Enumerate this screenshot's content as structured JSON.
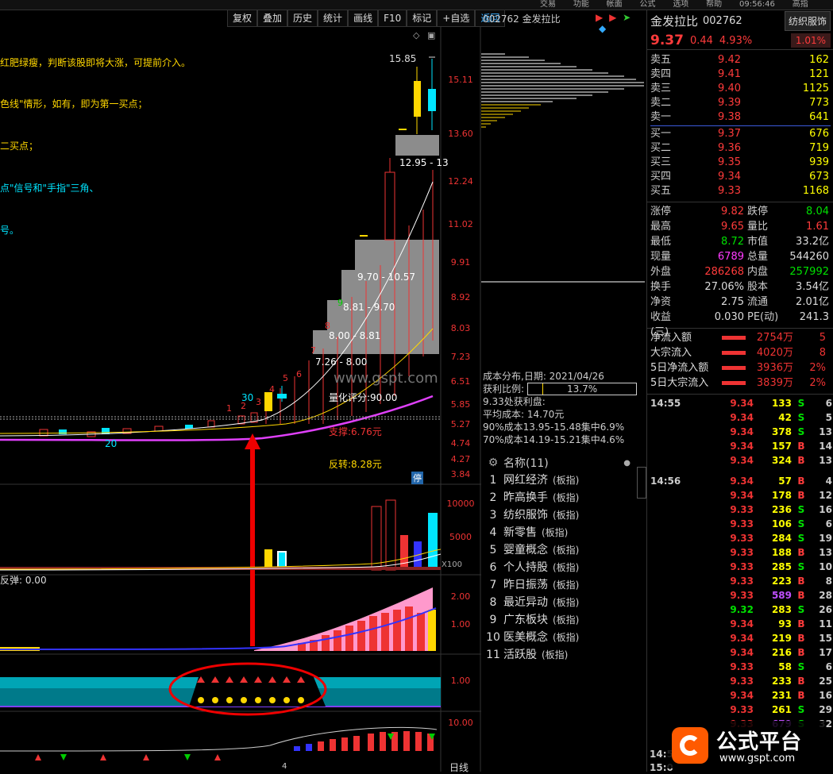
{
  "topbar": {
    "items": [
      "交易",
      "功能",
      "帐面",
      "公式",
      "选项",
      "帮助",
      "",
      "高指"
    ],
    "clock": "09:56:46"
  },
  "toolbar": {
    "buttons": [
      "复权",
      "叠加",
      "历史",
      "统计",
      "画线",
      "F10",
      "标记",
      "+自选",
      "返回"
    ]
  },
  "chart_header": {
    "code_name": "002762 金发拉比"
  },
  "annotations": {
    "note1": "红肥绿瘦，判断该股即将大涨，可提前介入。",
    "note2": "色线\"情形，如有，即为第一买点；",
    "note3": "二买点；",
    "note4": "点\"信号和\"手指\"三角、",
    "note5": "号。",
    "high_label": "15.85",
    "num30": "30",
    "num20": "20",
    "box1": "12.95 - 13",
    "box2": "9.70 - 10.57",
    "box3": "8.81 - 9.70",
    "box4": "8.00 - 8.81",
    "box5": "7.26 - 8.00",
    "score": "量化评分:90.00",
    "support": "支撑:6.76元",
    "reversal": "反转:8.28元",
    "ting": "停",
    "n1": "1",
    "n2": "2",
    "n3": "3",
    "n4": "4",
    "n5": "5",
    "n6": "6",
    "n7": "7",
    "n8": "8",
    "n9": "9",
    "watermark": "www.gspt.com",
    "x100": "X100",
    "rebound": "反弹: 0.00",
    "bottom_day": "日线",
    "bottom_4": "4",
    "logo_text": "公式平台",
    "logo_url": "www.gspt.com"
  },
  "price_axis": [
    "15.11",
    "13.60",
    "12.24",
    "11.02",
    "9.91",
    "8.92",
    "8.03",
    "7.23",
    "6.51",
    "5.85",
    "5.27",
    "4.74",
    "4.27",
    "3.84"
  ],
  "vol_axis": [
    "10000",
    "5000"
  ],
  "ind_axis": [
    "2.00",
    "1.00"
  ],
  "ind2_axis": [
    "1.00"
  ],
  "ind3_axis": [
    "10.00"
  ],
  "chip": {
    "date_label": "成本分布,日期: 2021/04/26",
    "profit_label": "获利比例:",
    "profit_value": "13.7%",
    "line1": "9.33处获利盘:",
    "line2": "平均成本: 14.70元",
    "line3": "90%成本13.95-15.48集中6.9%",
    "line4": "70%成本14.19-15.21集中4.6%"
  },
  "sectors": {
    "header": "名称(11)",
    "items": [
      {
        "idx": "1",
        "name": "网红经济",
        "tag": "(板指)"
      },
      {
        "idx": "2",
        "name": "昨高换手",
        "tag": "(板指)"
      },
      {
        "idx": "3",
        "name": "纺织服饰",
        "tag": "(板指)"
      },
      {
        "idx": "4",
        "name": "新零售",
        "tag": "(板指)"
      },
      {
        "idx": "5",
        "name": "婴童概念",
        "tag": "(板指)"
      },
      {
        "idx": "6",
        "name": "个人持股",
        "tag": "(板指)"
      },
      {
        "idx": "7",
        "name": "昨日振荡",
        "tag": "(板指)"
      },
      {
        "idx": "8",
        "name": "最近异动",
        "tag": "(板指)"
      },
      {
        "idx": "9",
        "name": "广东板块",
        "tag": "(板指)"
      },
      {
        "idx": "10",
        "name": "医美概念",
        "tag": "(板指)"
      },
      {
        "idx": "11",
        "name": "活跃股",
        "tag": "(板指)"
      }
    ]
  },
  "quote": {
    "name": "金发拉比",
    "code": "002762",
    "sector_btn": "纺织服饰",
    "price": "9.37",
    "change": "0.44",
    "pct": "4.93%",
    "ratio": "1.01%"
  },
  "orderbook": {
    "asks": [
      {
        "label": "卖五",
        "price": "9.42",
        "vol": "162"
      },
      {
        "label": "卖四",
        "price": "9.41",
        "vol": "121"
      },
      {
        "label": "卖三",
        "price": "9.40",
        "vol": "1125"
      },
      {
        "label": "卖二",
        "price": "9.39",
        "vol": "773"
      },
      {
        "label": "卖一",
        "price": "9.38",
        "vol": "641"
      }
    ],
    "bids": [
      {
        "label": "买一",
        "price": "9.37",
        "vol": "676"
      },
      {
        "label": "买二",
        "price": "9.36",
        "vol": "719"
      },
      {
        "label": "买三",
        "price": "9.35",
        "vol": "939"
      },
      {
        "label": "买四",
        "price": "9.34",
        "vol": "673"
      },
      {
        "label": "买五",
        "price": "9.33",
        "vol": "1168"
      }
    ]
  },
  "stats": [
    {
      "k": "涨停",
      "v": "9.82",
      "vc": "#ff3b3b",
      "k2": "跌停",
      "v2": "8.04",
      "v2c": "#00e000"
    },
    {
      "k": "最高",
      "v": "9.65",
      "vc": "#ff3b3b",
      "k2": "量比",
      "v2": "1.61",
      "v2c": "#ff3b3b"
    },
    {
      "k": "最低",
      "v": "8.72",
      "vc": "#00e000",
      "k2": "市值",
      "v2": "33.2亿",
      "v2c": "#ddd"
    },
    {
      "k": "现量",
      "v": "6789",
      "vc": "#ff3bff",
      "k2": "总量",
      "v2": "544260",
      "v2c": "#ddd"
    },
    {
      "k": "外盘",
      "v": "286268",
      "vc": "#ff3b3b",
      "k2": "内盘",
      "v2": "257992",
      "v2c": "#00e000"
    },
    {
      "k": "换手",
      "v": "27.06%",
      "vc": "#ddd",
      "k2": "股本",
      "v2": "3.54亿",
      "v2c": "#ddd"
    },
    {
      "k": "净资",
      "v": "2.75",
      "vc": "#ddd",
      "k2": "流通",
      "v2": "2.01亿",
      "v2c": "#ddd"
    },
    {
      "k": "收益(三)",
      "v": "0.030",
      "vc": "#ddd",
      "k2": "PE(动)",
      "v2": "241.3",
      "v2c": "#ddd"
    }
  ],
  "flows": [
    {
      "label": "净流入额",
      "val": "2754万",
      "tail": "5"
    },
    {
      "label": "大宗流入",
      "val": "4020万",
      "tail": "8"
    },
    {
      "label": "5日净流入额",
      "val": "3936万",
      "tail": "2%"
    },
    {
      "label": "5日大宗流入",
      "val": "3839万",
      "tail": "2%"
    }
  ],
  "ticks": [
    {
      "t": "14:55",
      "p": "9.34",
      "v": "133",
      "d": "S",
      "n": "6"
    },
    {
      "t": "",
      "p": "9.34",
      "v": "42",
      "d": "S",
      "n": "5"
    },
    {
      "t": "",
      "p": "9.34",
      "v": "378",
      "d": "S",
      "n": "13"
    },
    {
      "t": "",
      "p": "9.34",
      "v": "157",
      "d": "B",
      "n": "14"
    },
    {
      "t": "",
      "p": "9.34",
      "v": "324",
      "d": "B",
      "n": "13"
    },
    {
      "t": "14:56",
      "p": "9.34",
      "v": "57",
      "d": "B",
      "n": "4"
    },
    {
      "t": "",
      "p": "9.34",
      "v": "178",
      "d": "B",
      "n": "12"
    },
    {
      "t": "",
      "p": "9.33",
      "v": "236",
      "d": "S",
      "n": "16"
    },
    {
      "t": "",
      "p": "9.33",
      "v": "106",
      "d": "S",
      "n": "6"
    },
    {
      "t": "",
      "p": "9.33",
      "v": "284",
      "d": "S",
      "n": "19"
    },
    {
      "t": "",
      "p": "9.33",
      "v": "188",
      "d": "B",
      "n": "13"
    },
    {
      "t": "",
      "p": "9.33",
      "v": "285",
      "d": "S",
      "n": "10"
    },
    {
      "t": "",
      "p": "9.33",
      "v": "223",
      "d": "B",
      "n": "8"
    },
    {
      "t": "",
      "p": "9.33",
      "v": "589",
      "d": "B",
      "n": "28"
    },
    {
      "t": "",
      "p": "9.32",
      "v": "283",
      "d": "S",
      "n": "26"
    },
    {
      "t": "",
      "p": "9.34",
      "v": "93",
      "d": "B",
      "n": "11"
    },
    {
      "t": "",
      "p": "9.34",
      "v": "219",
      "d": "B",
      "n": "15"
    },
    {
      "t": "",
      "p": "9.34",
      "v": "216",
      "d": "B",
      "n": "17"
    },
    {
      "t": "",
      "p": "9.33",
      "v": "58",
      "d": "S",
      "n": "6"
    },
    {
      "t": "",
      "p": "9.33",
      "v": "233",
      "d": "B",
      "n": "25"
    },
    {
      "t": "",
      "p": "9.34",
      "v": "231",
      "d": "B",
      "n": "16"
    },
    {
      "t": "",
      "p": "9.33",
      "v": "261",
      "d": "S",
      "n": "29"
    },
    {
      "t": "",
      "p": "9.33",
      "v": "679",
      "d": "S",
      "n": "32"
    }
  ],
  "tick_time_3": "14:5",
  "tick_time_4": "15:0"
}
